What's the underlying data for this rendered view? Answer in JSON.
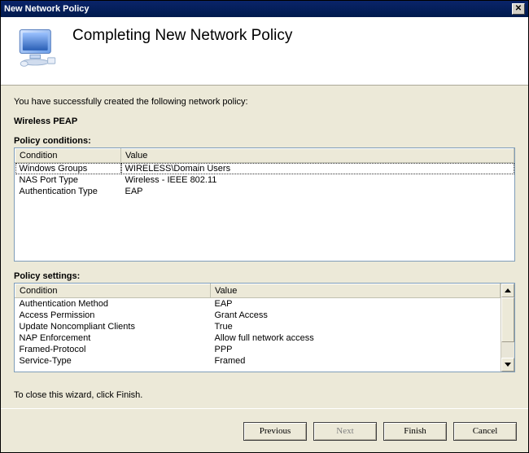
{
  "window": {
    "title": "New Network Policy"
  },
  "header": {
    "title": "Completing New Network Policy"
  },
  "body": {
    "intro": "You have successfully created the following network policy:",
    "policy_name": "Wireless PEAP",
    "conditions_label": "Policy conditions:",
    "settings_label": "Policy settings:",
    "columns": {
      "condition": "Condition",
      "value": "Value"
    },
    "conditions": [
      {
        "condition": "Windows Groups",
        "value": "WIRELESS\\Domain Users"
      },
      {
        "condition": "NAS Port Type",
        "value": "Wireless - IEEE 802.11"
      },
      {
        "condition": "Authentication Type",
        "value": "EAP"
      }
    ],
    "settings": [
      {
        "condition": "Authentication Method",
        "value": "EAP"
      },
      {
        "condition": "Access Permission",
        "value": "Grant Access"
      },
      {
        "condition": "Update Noncompliant Clients",
        "value": "True"
      },
      {
        "condition": "NAP Enforcement",
        "value": "Allow full network access"
      },
      {
        "condition": "Framed-Protocol",
        "value": "PPP"
      },
      {
        "condition": "Service-Type",
        "value": "Framed"
      }
    ],
    "hint": "To close this wizard, click Finish."
  },
  "footer": {
    "previous": "Previous",
    "next": "Next",
    "finish": "Finish",
    "cancel": "Cancel"
  }
}
